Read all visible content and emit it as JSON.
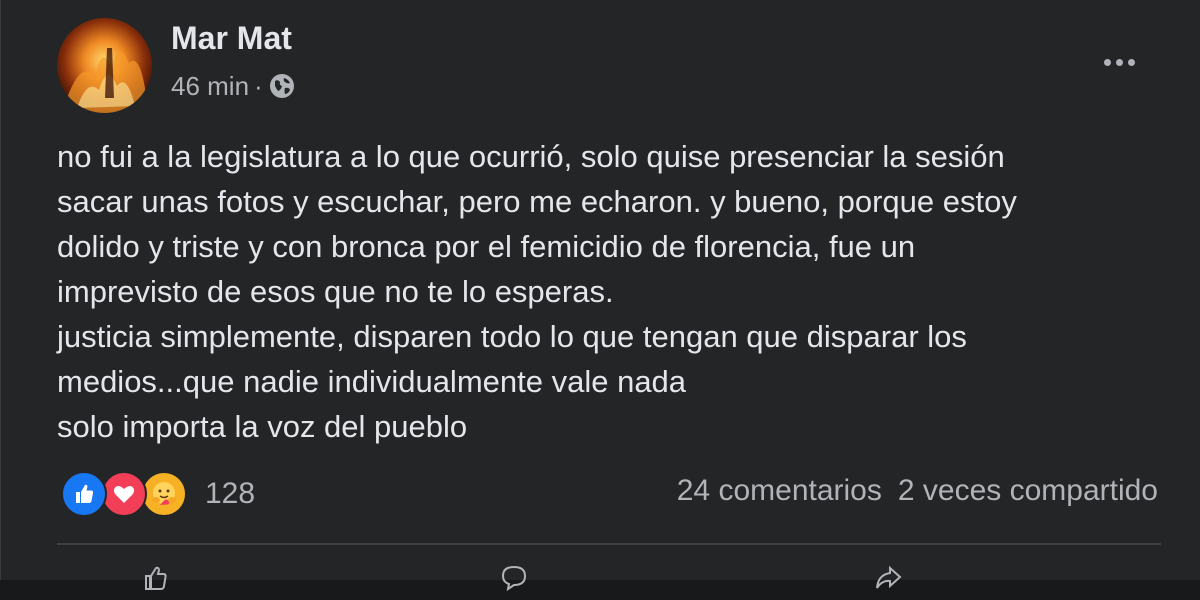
{
  "post": {
    "author": "Mar Mat",
    "time": "46 min",
    "separator": "·",
    "privacy_icon": "globe-icon",
    "more_icon": "more-options-icon",
    "text_lines": [
      "no fui a la legislatura a lo que ocurrió, solo quise presenciar la sesión",
      "sacar unas fotos y escuchar, pero me echaron. y bueno, porque estoy",
      "dolido y triste y con bronca por el femicidio de florencia, fue un",
      "imprevisto de esos que no te lo esperas.",
      "justicia simplemente, disparen todo lo que tengan que disparar los",
      "medios...que nadie individualmente vale nada",
      "solo importa la voz del pueblo"
    ]
  },
  "reactions": {
    "icons": [
      "like-icon",
      "love-icon",
      "care-icon"
    ],
    "count": "128"
  },
  "stats": {
    "comments": "24 comentarios",
    "shares": "2 veces compartido"
  },
  "actions": [
    {
      "icon": "like-icon"
    },
    {
      "icon": "comment-icon"
    },
    {
      "icon": "share-icon"
    }
  ],
  "colors": {
    "background": "#242526",
    "text": "#e4e6eb",
    "secondary_text": "#b0b3b8",
    "like": "#1877f2",
    "love": "#f33e58",
    "care": "#f7b125"
  }
}
